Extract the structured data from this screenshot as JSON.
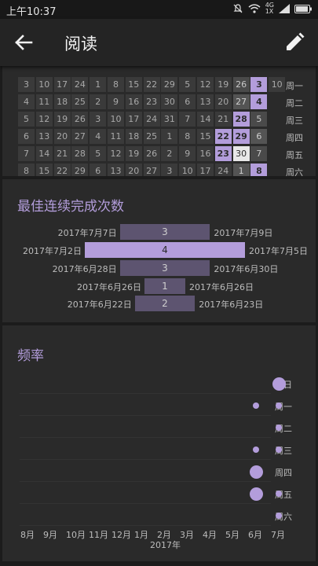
{
  "status": {
    "time": "上午10:37",
    "battery_icon": "battery-icon",
    "wifi_icon": "wifi-icon",
    "signal_label": "4G",
    "signal_sub": "1X"
  },
  "appbar": {
    "title": "阅读",
    "back_icon": "arrow-left-icon",
    "edit_icon": "pencil-icon"
  },
  "colors": {
    "accent": "#b39ddb",
    "bg": "#2a2a2a",
    "muted_bar": "#5d5470"
  },
  "heatmap": {
    "rows": [
      {
        "day": "周一",
        "cells": [
          "3",
          "10",
          "17",
          "24",
          "1",
          "8",
          "15",
          "22",
          "29",
          "5",
          "12",
          "19",
          "26",
          "3",
          "10"
        ],
        "levels": [
          0,
          0,
          0,
          0,
          0,
          0,
          0,
          0,
          0,
          0,
          0,
          0,
          2,
          3,
          0
        ]
      },
      {
        "day": "周二",
        "cells": [
          "4",
          "11",
          "18",
          "25",
          "2",
          "9",
          "16",
          "23",
          "30",
          "6",
          "13",
          "20",
          "27",
          "4",
          ""
        ],
        "levels": [
          0,
          0,
          0,
          0,
          0,
          0,
          0,
          0,
          0,
          0,
          0,
          0,
          1,
          3,
          -1
        ]
      },
      {
        "day": "周三",
        "cells": [
          "5",
          "12",
          "19",
          "26",
          "3",
          "10",
          "17",
          "24",
          "31",
          "7",
          "14",
          "21",
          "28",
          "5",
          ""
        ],
        "levels": [
          0,
          0,
          0,
          0,
          0,
          0,
          0,
          0,
          0,
          0,
          0,
          0,
          3,
          2,
          -1
        ]
      },
      {
        "day": "周四",
        "cells": [
          "6",
          "13",
          "20",
          "27",
          "4",
          "11",
          "18",
          "25",
          "1",
          "8",
          "15",
          "22",
          "29",
          "6",
          ""
        ],
        "levels": [
          0,
          0,
          0,
          0,
          0,
          0,
          0,
          0,
          0,
          0,
          0,
          3,
          3,
          1,
          -1
        ]
      },
      {
        "day": "周五",
        "cells": [
          "7",
          "14",
          "21",
          "28",
          "5",
          "12",
          "19",
          "26",
          "2",
          "9",
          "16",
          "23",
          "30",
          "7",
          ""
        ],
        "levels": [
          0,
          0,
          0,
          0,
          0,
          0,
          0,
          0,
          0,
          0,
          0,
          3,
          4,
          2,
          -1
        ]
      },
      {
        "day": "周六",
        "cells": [
          "8",
          "15",
          "22",
          "29",
          "6",
          "13",
          "20",
          "27",
          "3",
          "10",
          "17",
          "24",
          "1",
          "8",
          ""
        ],
        "levels": [
          0,
          0,
          0,
          0,
          0,
          0,
          0,
          0,
          0,
          0,
          0,
          0,
          1,
          3,
          -1
        ]
      }
    ]
  },
  "streaks": {
    "title": "最佳连续完成次数",
    "items": [
      {
        "start": "2017年7月7日",
        "end": "2017年7月9日",
        "count": "3",
        "best": false
      },
      {
        "start": "2017年7月2日",
        "end": "2017年7月5日",
        "count": "4",
        "best": true
      },
      {
        "start": "2017年6月28日",
        "end": "2017年6月30日",
        "count": "3",
        "best": false
      },
      {
        "start": "2017年6月26日",
        "end": "2017年6月26日",
        "count": "1",
        "best": false
      },
      {
        "start": "2017年6月22日",
        "end": "2017年6月23日",
        "count": "2",
        "best": false
      }
    ]
  },
  "frequency": {
    "title": "频率",
    "days": [
      "周日",
      "周一",
      "周二",
      "周三",
      "周四",
      "周五",
      "周六"
    ],
    "months": [
      "8月",
      "9月",
      "10月",
      "11月",
      "12月",
      "1月",
      "2月",
      "3月",
      "4月",
      "5月",
      "6月",
      "7月"
    ],
    "year": "2017年",
    "dots": [
      {
        "day": 0,
        "month": 11,
        "size": 3
      },
      {
        "day": 1,
        "month": 10,
        "size": 1
      },
      {
        "day": 1,
        "month": 11,
        "size": 1
      },
      {
        "day": 2,
        "month": 11,
        "size": 1
      },
      {
        "day": 3,
        "month": 10,
        "size": 1
      },
      {
        "day": 3,
        "month": 11,
        "size": 1
      },
      {
        "day": 4,
        "month": 10,
        "size": 3
      },
      {
        "day": 5,
        "month": 10,
        "size": 3
      },
      {
        "day": 5,
        "month": 11,
        "size": 1
      },
      {
        "day": 6,
        "month": 11,
        "size": 1
      }
    ]
  }
}
